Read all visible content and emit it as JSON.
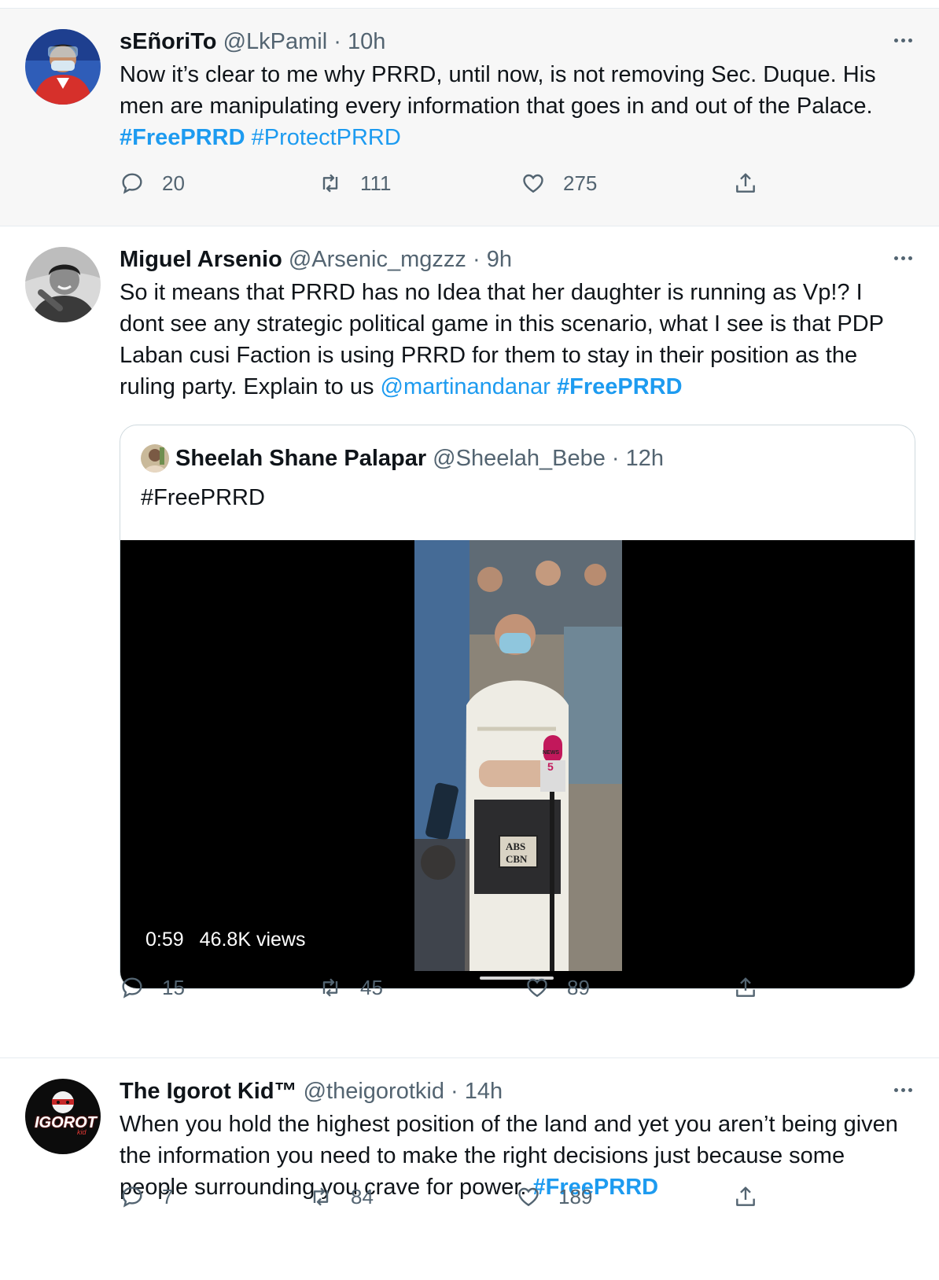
{
  "tweets": [
    {
      "name": "sEñoriTo",
      "handle": "@LkPamil",
      "dot": "·",
      "time": "10h",
      "text_pre": "Now it’s clear to me why PRRD, until now, is not removing Sec. Duque. His men are manipulating every information that goes in and out of the Palace.",
      "tags": [
        "#FreePRRD",
        "#ProtectPRRD"
      ],
      "replies": "20",
      "retweets": "111",
      "likes": "275"
    },
    {
      "name": "Miguel Arsenio",
      "handle": "@Arsenic_mgzzz",
      "dot": "·",
      "time": "9h",
      "text_pre": "So it means that PRRD has no Idea that her daughter is running as Vp!? I dont see any strategic political game in this scenario, what I see is that PDP Laban cusi Faction is using PRRD for them to stay in their position as the ruling party. Explain to us",
      "mention": "@martinandanar",
      "tag": "#FreePRRD",
      "quote": {
        "name": "Sheelah Shane Palapar",
        "handle": "@Sheelah_Bebe",
        "dot": "·",
        "time": "12h",
        "text": "#FreePRRD",
        "video": {
          "duration": "0:59",
          "views": "46.8K views",
          "overlay_texts": [
            "NEWS",
            "5",
            "ABS",
            "CBN"
          ]
        }
      },
      "replies": "15",
      "retweets": "45",
      "likes": "89"
    },
    {
      "name": "The Igorot Kid™",
      "handle": "@theigorotkid",
      "dot": "·",
      "time": "14h",
      "avatar_text": "IGOROT",
      "avatar_subtext": "kid",
      "text_pre": "When you hold the highest position of the land and yet you aren’t being given the information you need to make the right decisions just because some people surrounding you crave for power.",
      "tag": "#FreePRRD",
      "replies": "7",
      "retweets": "84",
      "likes": "189"
    }
  ],
  "colors": {
    "link": "#1d9bf0",
    "secondary": "#536471",
    "highlight_bg": "#f7f7f7"
  },
  "icons": [
    "reply-icon",
    "retweet-icon",
    "like-icon",
    "share-icon",
    "more-icon"
  ]
}
